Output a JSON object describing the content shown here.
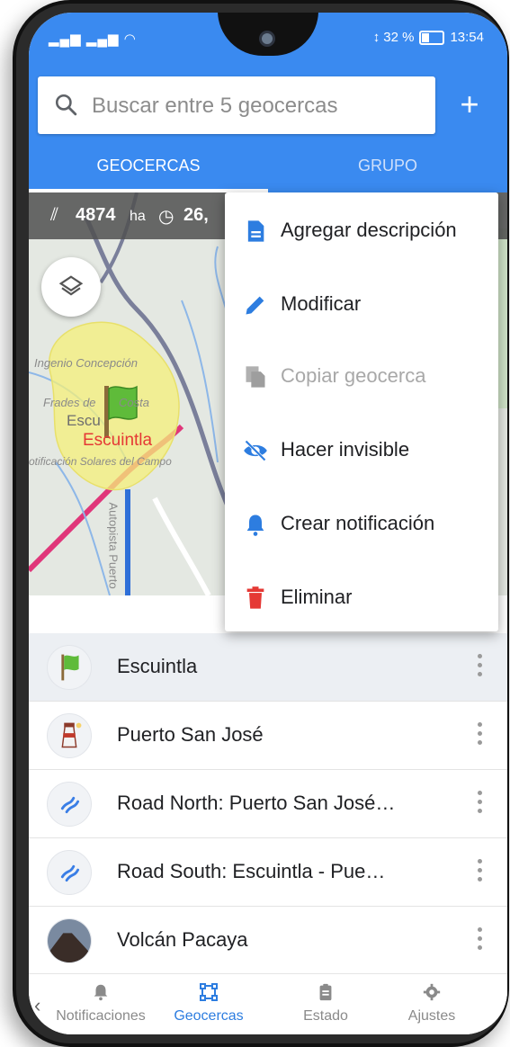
{
  "status_bar": {
    "signal": "▂▄▆ ▂▄▆ ◠",
    "battery": "32 %",
    "time": "13:54"
  },
  "search": {
    "placeholder": "Buscar entre 5 geocercas",
    "add_label": "+"
  },
  "tabs": [
    {
      "label": "GEOCERCAS"
    },
    {
      "label": "GRUPO"
    }
  ],
  "map": {
    "area": "4874",
    "area_unit": "ha",
    "time": "26,",
    "labels": {
      "ingenio": "Ingenio Concepción",
      "frades": "Frades de",
      "costa": "Costa",
      "esc": "Escu",
      "escuintla": "Escuintla",
      "lotificacion": "otificación Solares del Campo",
      "autopista": "Autopista Puerto"
    }
  },
  "context_menu": {
    "items": [
      {
        "label": "Agregar descripción",
        "icon": "document-icon",
        "disabled": false
      },
      {
        "label": "Modificar",
        "icon": "pencil-icon",
        "disabled": false
      },
      {
        "label": "Copiar geocerca",
        "icon": "copy-icon",
        "disabled": true
      },
      {
        "label": "Hacer invisible",
        "icon": "eye-off-icon",
        "disabled": false
      },
      {
        "label": "Crear notificación",
        "icon": "bell-icon",
        "disabled": false
      },
      {
        "label": "Eliminar",
        "icon": "trash-icon",
        "disabled": false
      }
    ]
  },
  "geofences": [
    {
      "name": "Escuintla",
      "icon": "green-flag-icon",
      "selected": true
    },
    {
      "name": "Puerto San José",
      "icon": "lighthouse-icon",
      "selected": false
    },
    {
      "name": "Road North: Puerto San José…",
      "icon": "road-icon",
      "selected": false
    },
    {
      "name": "Road South: Escuintla - Pue…",
      "icon": "road-icon",
      "selected": false
    },
    {
      "name": "Volcán Pacaya",
      "icon": "volcano-photo",
      "selected": false
    }
  ],
  "bottom_nav": [
    {
      "label": "Notificaciones",
      "icon": "bell-icon",
      "active": false
    },
    {
      "label": "Geocercas",
      "icon": "polygon-icon",
      "active": true
    },
    {
      "label": "Estado",
      "icon": "clipboard-icon",
      "active": false
    },
    {
      "label": "Ajustes",
      "icon": "gear-icon",
      "active": false
    }
  ],
  "colors": {
    "primary": "#3a8af0",
    "geofence_fill": "#f5f07a",
    "label_red": "#e53935",
    "delete_red": "#e53935",
    "nav_active": "#2d7de0"
  }
}
